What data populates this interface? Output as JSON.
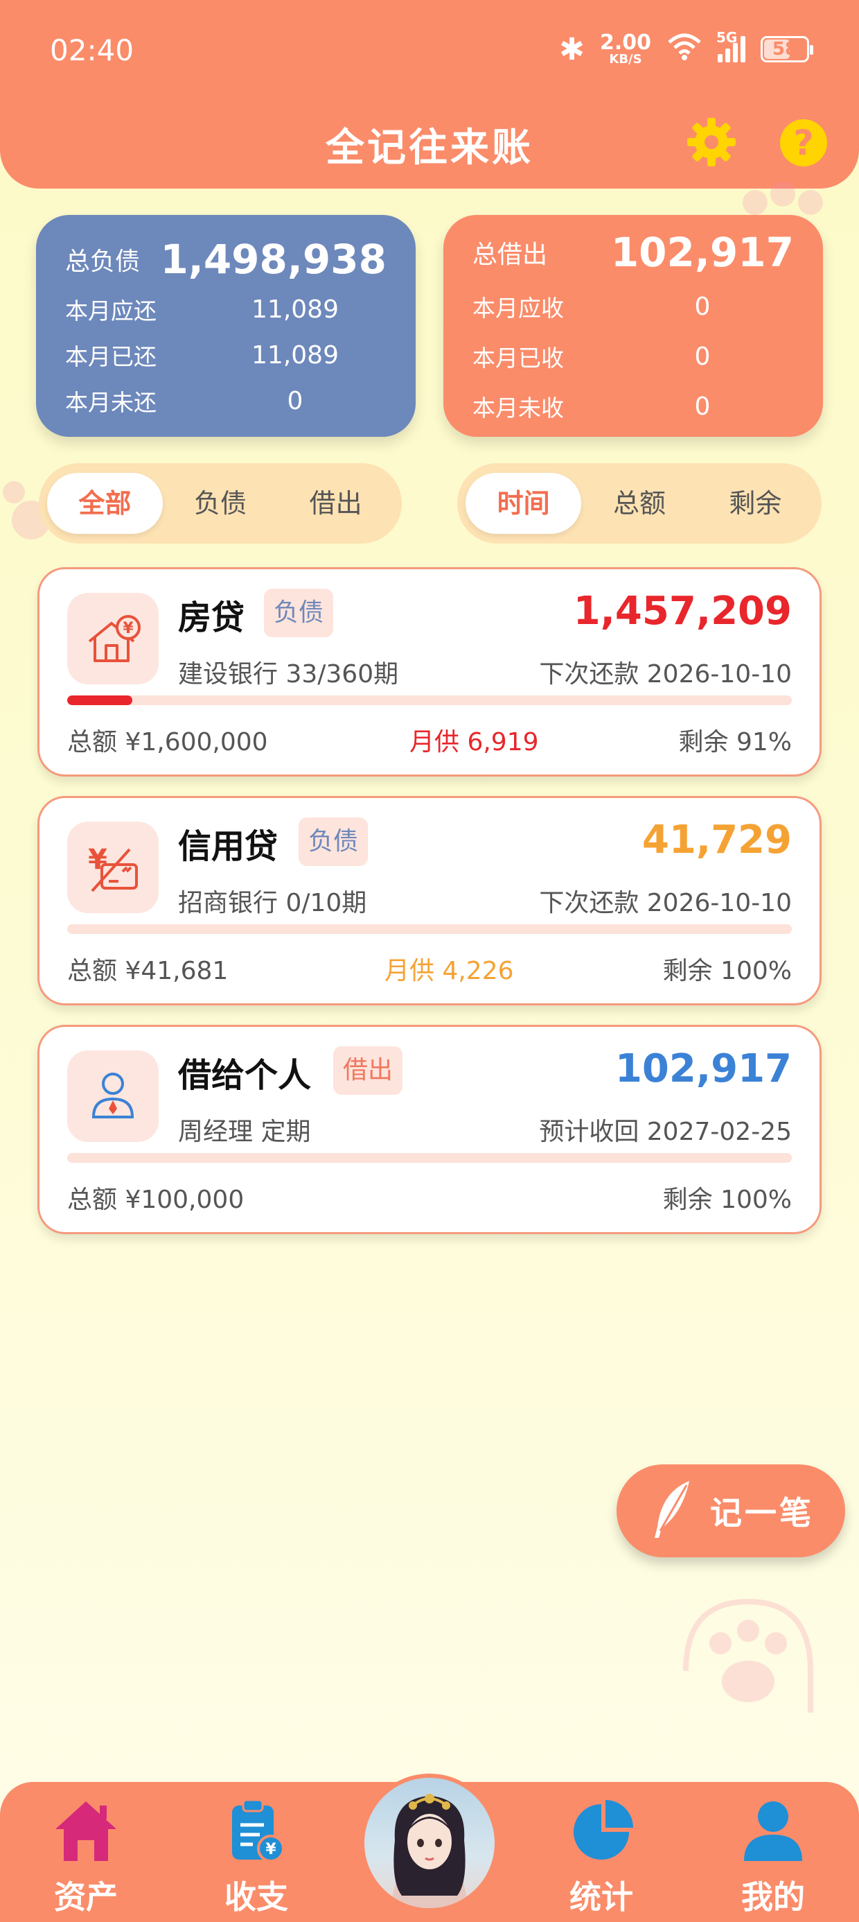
{
  "status_bar": {
    "time": "02:40",
    "net_speed": "2.00",
    "net_unit": "KB/S",
    "signal_label": "5G",
    "battery": "58"
  },
  "header": {
    "title": "全记往来账"
  },
  "summary": {
    "debt": {
      "total_label": "总负债",
      "total_value": "1,498,938",
      "rows": [
        {
          "label": "本月应还",
          "value": "11,089"
        },
        {
          "label": "本月已还",
          "value": "11,089"
        },
        {
          "label": "本月未还",
          "value": "0"
        }
      ]
    },
    "lend": {
      "total_label": "总借出",
      "total_value": "102,917",
      "rows": [
        {
          "label": "本月应收",
          "value": "0"
        },
        {
          "label": "本月已收",
          "value": "0"
        },
        {
          "label": "本月未收",
          "value": "0"
        }
      ]
    }
  },
  "filters": {
    "type": [
      {
        "label": "全部",
        "active": true
      },
      {
        "label": "负债",
        "active": false
      },
      {
        "label": "借出",
        "active": false
      }
    ],
    "sort": [
      {
        "label": "时间",
        "active": true
      },
      {
        "label": "总额",
        "active": false
      },
      {
        "label": "剩余",
        "active": false
      }
    ]
  },
  "entries": [
    {
      "name": "房贷",
      "tag": "负债",
      "amount": "1,457,209",
      "amount_color": "#e8262b",
      "sub": "建设银行 33/360期",
      "next": "下次还款 2026-10-10",
      "progress": 0.09,
      "total": "总额 ¥1,600,000",
      "monthly": "月供 6,919",
      "monthly_color": "#e8262b",
      "remain": "剩余 91%",
      "icon": "house-yuan-icon"
    },
    {
      "name": "信用贷",
      "tag": "负债",
      "amount": "41,729",
      "amount_color": "#f5a234",
      "sub": "招商银行 0/10期",
      "next": "下次还款 2026-10-10",
      "progress": 0.0,
      "total": "总额 ¥41,681",
      "monthly": "月供 4,226",
      "monthly_color": "#f5a234",
      "remain": "剩余 100%",
      "icon": "credit-card-yuan-icon"
    },
    {
      "name": "借给个人",
      "tag": "借出",
      "amount": "102,917",
      "amount_color": "#3b82d6",
      "sub": "周经理 定期",
      "next": "预计收回 2027-02-25",
      "progress": 0.0,
      "total": "总额 ¥100,000",
      "monthly": "",
      "monthly_color": "#555555",
      "remain": "剩余 100%",
      "icon": "person-icon"
    }
  ],
  "fab": {
    "label": "记一笔",
    "icon": "feather-pen-icon"
  },
  "bottom_nav": [
    {
      "label": "资产",
      "icon": "home-icon"
    },
    {
      "label": "收支",
      "icon": "clipboard-yuan-icon"
    },
    {
      "label": "",
      "icon": "avatar"
    },
    {
      "label": "统计",
      "icon": "pie-chart-icon"
    },
    {
      "label": "我的",
      "icon": "user-icon"
    }
  ],
  "colors": {
    "accent": "#fa8c6a",
    "debt_card": "#6d88bb",
    "highlight": "#f26d4f"
  }
}
